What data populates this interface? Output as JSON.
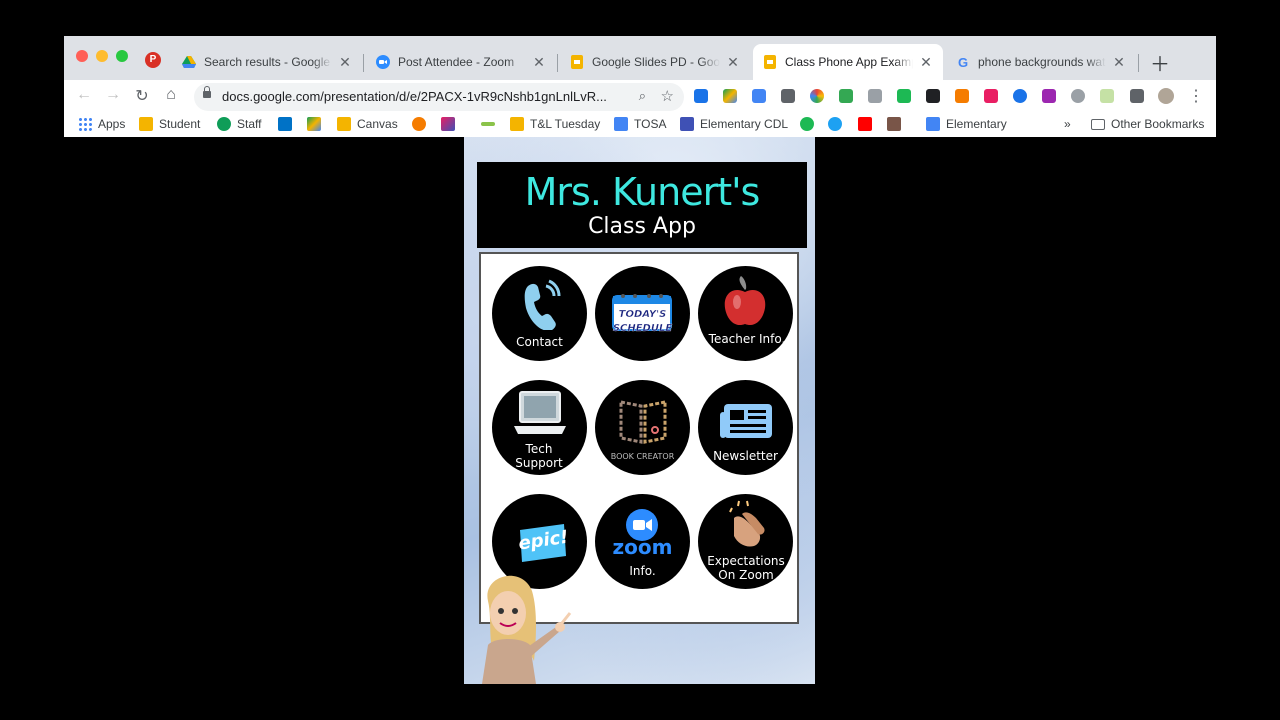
{
  "tabs": [
    {
      "title": "Search results - Google Drive",
      "icon": "drive-icon",
      "active": false
    },
    {
      "title": "Post Attendee - Zoom",
      "icon": "zoom-icon",
      "active": false
    },
    {
      "title": "Google Slides PD - Google Slides",
      "icon": "slides-icon",
      "active": false
    },
    {
      "title": "Class Phone App Example",
      "icon": "slides-icon",
      "active": true
    },
    {
      "title": "phone backgrounds watercolor",
      "icon": "google-icon",
      "active": false
    }
  ],
  "profile_initial": "P",
  "address_bar": {
    "url": "docs.google.com/presentation/d/e/2PACX-1vR9cNshb1gnLnlLvR..."
  },
  "bookmarks": [
    {
      "label": "Apps",
      "color": "#4285f4"
    },
    {
      "label": "Student",
      "color": "#f4b400"
    },
    {
      "label": "Staff",
      "color": "#0f9d58"
    },
    {
      "label": "Canvas",
      "color": "#f4b400"
    },
    {
      "label": "T&L Tuesday",
      "color": "#f4b400"
    },
    {
      "label": "TOSA",
      "color": "#4285f4"
    },
    {
      "label": "Elementary CDL",
      "color": "#3f51b5"
    },
    {
      "label": "Elementary",
      "color": "#4285f4"
    }
  ],
  "bookmarks_overflow": "»",
  "other_bookmarks": "Other Bookmarks",
  "slide": {
    "title": "Mrs. Kunert's",
    "subtitle": "Class App",
    "apps": [
      {
        "label": "Contact",
        "icon": "phone-icon"
      },
      {
        "label": "TODAY'S SCHEDULE",
        "icon": "calendar-icon"
      },
      {
        "label": "Teacher Info.",
        "icon": "apple-icon"
      },
      {
        "label": "Tech Support",
        "icon": "laptop-icon"
      },
      {
        "label": "BOOK CREATOR",
        "icon": "book-creator-icon"
      },
      {
        "label": "Newsletter",
        "icon": "newsletter-icon"
      },
      {
        "label": "epic!",
        "icon": "epic-icon"
      },
      {
        "label": "zoom",
        "sublabel": "Info.",
        "icon": "zoom-icon"
      },
      {
        "label": "Expectations On Zoom",
        "icon": "clapping-hands-icon"
      }
    ]
  }
}
